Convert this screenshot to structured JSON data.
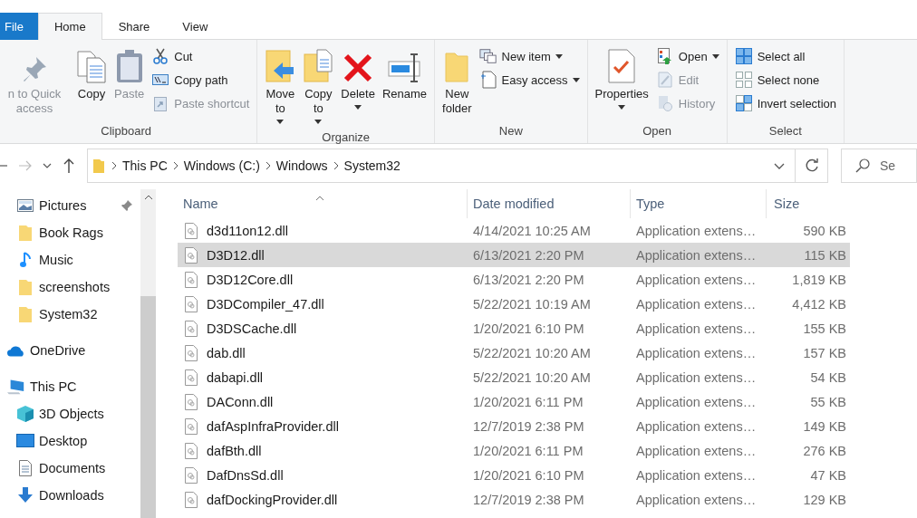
{
  "tabs": [
    {
      "label": "File",
      "kind": "file",
      "selected": false
    },
    {
      "label": "Home",
      "kind": "tab",
      "selected": true
    },
    {
      "label": "Share",
      "kind": "tab",
      "selected": false
    },
    {
      "label": "View",
      "kind": "tab",
      "selected": false
    }
  ],
  "ribbon": {
    "groups": [
      {
        "label": "Clipboard",
        "items": [
          {
            "label": "n to Quick access",
            "kind": "large",
            "disabled": true,
            "dropdown": false
          },
          {
            "label": "Copy",
            "kind": "large",
            "disabled": false,
            "dropdown": false
          },
          {
            "label": "Paste",
            "kind": "large",
            "disabled": true,
            "dropdown": false
          },
          {
            "label": "Cut",
            "kind": "small",
            "disabled": false,
            "dropdown": false
          },
          {
            "label": "Copy path",
            "kind": "small",
            "disabled": false,
            "dropdown": false
          },
          {
            "label": "Paste shortcut",
            "kind": "small",
            "disabled": true,
            "dropdown": false
          }
        ]
      },
      {
        "label": "Organize",
        "items": [
          {
            "label": "Move to",
            "kind": "large",
            "disabled": false,
            "dropdown": true
          },
          {
            "label": "Copy to",
            "kind": "large",
            "disabled": false,
            "dropdown": true
          },
          {
            "label": "Delete",
            "kind": "large",
            "disabled": false,
            "dropdown": true
          },
          {
            "label": "Rename",
            "kind": "large",
            "disabled": false,
            "dropdown": false
          }
        ]
      },
      {
        "label": "New",
        "items": [
          {
            "label": "New folder",
            "kind": "large",
            "disabled": false,
            "dropdown": false
          },
          {
            "label": "New item",
            "kind": "small",
            "disabled": false,
            "dropdown": true
          },
          {
            "label": "Easy access",
            "kind": "small",
            "disabled": false,
            "dropdown": true
          }
        ]
      },
      {
        "label": "Open",
        "items": [
          {
            "label": "Properties",
            "kind": "large",
            "disabled": false,
            "dropdown": true
          },
          {
            "label": "Open",
            "kind": "small",
            "disabled": false,
            "dropdown": true
          },
          {
            "label": "Edit",
            "kind": "small",
            "disabled": true,
            "dropdown": false
          },
          {
            "label": "History",
            "kind": "small",
            "disabled": true,
            "dropdown": false
          }
        ]
      },
      {
        "label": "Select",
        "items": [
          {
            "label": "Select all",
            "kind": "small",
            "disabled": false,
            "dropdown": false
          },
          {
            "label": "Select none",
            "kind": "small",
            "disabled": false,
            "dropdown": false
          },
          {
            "label": "Invert selection",
            "kind": "small",
            "disabled": false,
            "dropdown": false
          }
        ]
      }
    ]
  },
  "address_bar": {
    "breadcrumbs": [
      "This PC",
      "Windows (C:)",
      "Windows",
      "System32"
    ]
  },
  "search": {
    "placeholder": "Se"
  },
  "sidebar": {
    "quick_access": [
      {
        "label": "Pictures",
        "kind": "pictures",
        "pinned": true
      },
      {
        "label": "Book Rags",
        "kind": "folder",
        "pinned": false
      },
      {
        "label": "Music",
        "kind": "music",
        "pinned": false
      },
      {
        "label": "screenshots",
        "kind": "folder",
        "pinned": false
      },
      {
        "label": "System32",
        "kind": "folder",
        "pinned": false
      }
    ],
    "items": [
      {
        "label": "OneDrive",
        "kind": "cloud"
      },
      {
        "label": "This PC",
        "kind": "pc",
        "children": [
          {
            "label": "3D Objects",
            "kind": "objects"
          },
          {
            "label": "Desktop",
            "kind": "desktop"
          },
          {
            "label": "Documents",
            "kind": "documents"
          },
          {
            "label": "Downloads",
            "kind": "downloads"
          }
        ]
      }
    ]
  },
  "table": {
    "columns": [
      "Name",
      "Date modified",
      "Type",
      "Size"
    ],
    "rows": [
      {
        "name": "d3d11on12.dll",
        "date": "4/14/2021 10:25 AM",
        "type": "Application extens…",
        "size": "590 KB",
        "selected": false
      },
      {
        "name": "D3D12.dll",
        "date": "6/13/2021 2:20 PM",
        "type": "Application extens…",
        "size": "115 KB",
        "selected": true
      },
      {
        "name": "D3D12Core.dll",
        "date": "6/13/2021 2:20 PM",
        "type": "Application extens…",
        "size": "1,819 KB",
        "selected": false
      },
      {
        "name": "D3DCompiler_47.dll",
        "date": "5/22/2021 10:19 AM",
        "type": "Application extens…",
        "size": "4,412 KB",
        "selected": false
      },
      {
        "name": "D3DSCache.dll",
        "date": "1/20/2021 6:10 PM",
        "type": "Application extens…",
        "size": "155 KB",
        "selected": false
      },
      {
        "name": "dab.dll",
        "date": "5/22/2021 10:20 AM",
        "type": "Application extens…",
        "size": "157 KB",
        "selected": false
      },
      {
        "name": "dabapi.dll",
        "date": "5/22/2021 10:20 AM",
        "type": "Application extens…",
        "size": "54 KB",
        "selected": false
      },
      {
        "name": "DAConn.dll",
        "date": "1/20/2021 6:11 PM",
        "type": "Application extens…",
        "size": "55 KB",
        "selected": false
      },
      {
        "name": "dafAspInfraProvider.dll",
        "date": "12/7/2019 2:38 PM",
        "type": "Application extens…",
        "size": "149 KB",
        "selected": false
      },
      {
        "name": "dafBth.dll",
        "date": "1/20/2021 6:11 PM",
        "type": "Application extens…",
        "size": "276 KB",
        "selected": false
      },
      {
        "name": "DafDnsSd.dll",
        "date": "1/20/2021 6:10 PM",
        "type": "Application extens…",
        "size": "47 KB",
        "selected": false
      },
      {
        "name": "dafDockingProvider.dll",
        "date": "12/7/2019 2:38 PM",
        "type": "Application extens…",
        "size": "129 KB",
        "selected": false
      }
    ]
  }
}
